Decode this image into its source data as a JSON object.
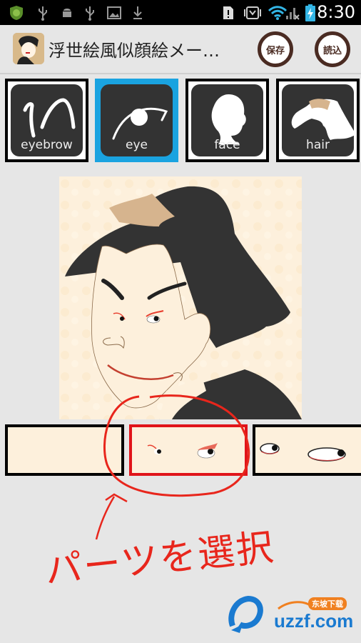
{
  "status_bar": {
    "time": "8:30",
    "left_icons": [
      "shield-bug-icon",
      "usb-icon",
      "android-icon",
      "usb-icon",
      "image-icon",
      "download-icon"
    ],
    "right_icons": [
      "sim-alert-icon",
      "robot-icon",
      "wifi-icon",
      "signal-icon",
      "battery-charging-icon"
    ]
  },
  "action_bar": {
    "title": "浮世絵風似顔絵メー…",
    "save_label": "保存",
    "load_label": "読込"
  },
  "part_tabs": [
    {
      "label": "eyebrow",
      "icon": "eyebrow-icon",
      "active": false
    },
    {
      "label": "eye",
      "icon": "eye-icon",
      "active": true
    },
    {
      "label": "face",
      "icon": "face-icon",
      "active": false
    },
    {
      "label": "hair",
      "icon": "hair-icon",
      "active": false
    }
  ],
  "canvas": {
    "subject": "ukiyo-e portrait"
  },
  "part_options": [
    {
      "name": "none",
      "selected": false
    },
    {
      "name": "eye-style-red-liner",
      "selected": true
    },
    {
      "name": "eye-style-side-glance",
      "selected": false
    }
  ],
  "annotation": {
    "text": "パーツを選択",
    "color": "#e8261c"
  },
  "watermark": {
    "brand": "uzzf.com",
    "tag": "东坡下载"
  },
  "colors": {
    "accent": "#1aa3e0",
    "selection": "#e0141a",
    "button_ring": "#4a2b22",
    "paper": "#fdf0dc",
    "hair": "#333333"
  }
}
